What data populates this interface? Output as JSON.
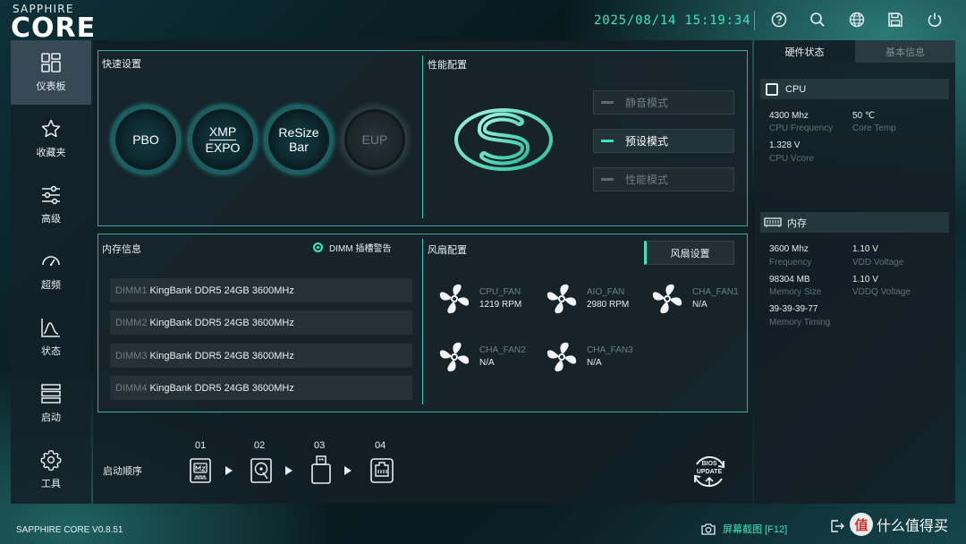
{
  "header": {
    "brand_top": "SAPPHIRE",
    "brand_main": "CORE",
    "datetime": "2025/08/14  15:19:34",
    "icons": [
      "help-icon",
      "search-icon",
      "globe-icon",
      "save-icon",
      "power-icon"
    ]
  },
  "sidebar": {
    "items": [
      {
        "label": "仪表板",
        "icon": "dashboard-icon",
        "active": true
      },
      {
        "label": "收藏夹",
        "icon": "star-icon",
        "active": false
      },
      {
        "label": "高级",
        "icon": "sliders-icon",
        "active": false
      },
      {
        "label": "超频",
        "icon": "gauge-icon",
        "active": false
      },
      {
        "label": "状态",
        "icon": "chart-icon",
        "active": false
      },
      {
        "label": "启动",
        "icon": "server-icon",
        "active": false
      },
      {
        "label": "工具",
        "icon": "gear-icon",
        "active": false
      }
    ]
  },
  "quick": {
    "title": "快速设置",
    "pbo": "PBO",
    "xmp_top": "XMP",
    "xmp_bottom": "EXPO",
    "resize_top": "ReSize",
    "resize_bottom": "Bar",
    "eup": "EUP"
  },
  "performance": {
    "title": "性能配置",
    "modes": [
      {
        "label": "静音模式",
        "active": false
      },
      {
        "label": "预设模式",
        "active": true
      },
      {
        "label": "性能模式",
        "active": false
      }
    ]
  },
  "memory": {
    "title": "内存信息",
    "warning_label": "DIMM 插槽警告",
    "dimms": [
      {
        "slot": "DIMM1",
        "value": "KingBank DDR5 24GB 3600MHz"
      },
      {
        "slot": "DIMM2",
        "value": "KingBank DDR5 24GB 3600MHz"
      },
      {
        "slot": "DIMM3",
        "value": "KingBank DDR5 24GB 3600MHz"
      },
      {
        "slot": "DIMM4",
        "value": "KingBank DDR5 24GB 3600MHz"
      }
    ]
  },
  "fans": {
    "title": "风扇配置",
    "settings_label": "风扇设置",
    "items": [
      {
        "name": "CPU_FAN",
        "rpm": "1219 RPM"
      },
      {
        "name": "AIO_FAN",
        "rpm": "2980 RPM"
      },
      {
        "name": "CHA_FAN1",
        "rpm": "N/A"
      },
      {
        "name": "CHA_FAN2",
        "rpm": "N/A"
      },
      {
        "name": "CHA_FAN3",
        "rpm": "N/A"
      }
    ]
  },
  "boot": {
    "title": "启动顺序",
    "order": [
      "01",
      "02",
      "03",
      "04"
    ],
    "devices": [
      "m2-drive-icon",
      "hard-disk-icon",
      "usb-drive-icon",
      "network-card-icon"
    ],
    "bios_line1": "BIOS",
    "bios_line2": "UPDATE"
  },
  "right": {
    "tabs": [
      {
        "label": "硬件状态",
        "active": true
      },
      {
        "label": "基本信息",
        "active": false
      }
    ],
    "cpu": {
      "title": "CPU",
      "freq_value": "4300 Mhz",
      "freq_label": "CPU Frequency",
      "temp_value": "50 ℃",
      "temp_label": "Core Temp",
      "vcore_value": "1.328 V",
      "vcore_label": "CPU Vcore"
    },
    "mem": {
      "title": "内存",
      "freq_value": "3600 Mhz",
      "freq_label": "Frequency",
      "vdd_value": "1.10 V",
      "vdd_label": "VDD Voltage",
      "size_value": "98304 MB",
      "size_label": "Memory Size",
      "vddq_value": "1.10 V",
      "vddq_label": "VDDQ Voltage",
      "timing_value": "39-39-39-77",
      "timing_label": "Memory Timing"
    }
  },
  "footer": {
    "version": "SAPPHIRE CORE V0.8.51",
    "screenshot": "屏幕截图 [F12]",
    "exit": "退出",
    "watermark_badge": "值",
    "watermark_text": "什么值得买"
  },
  "colors": {
    "accent": "#3fe3c0",
    "border": "#3aa9a1",
    "panel": "#121f25"
  }
}
